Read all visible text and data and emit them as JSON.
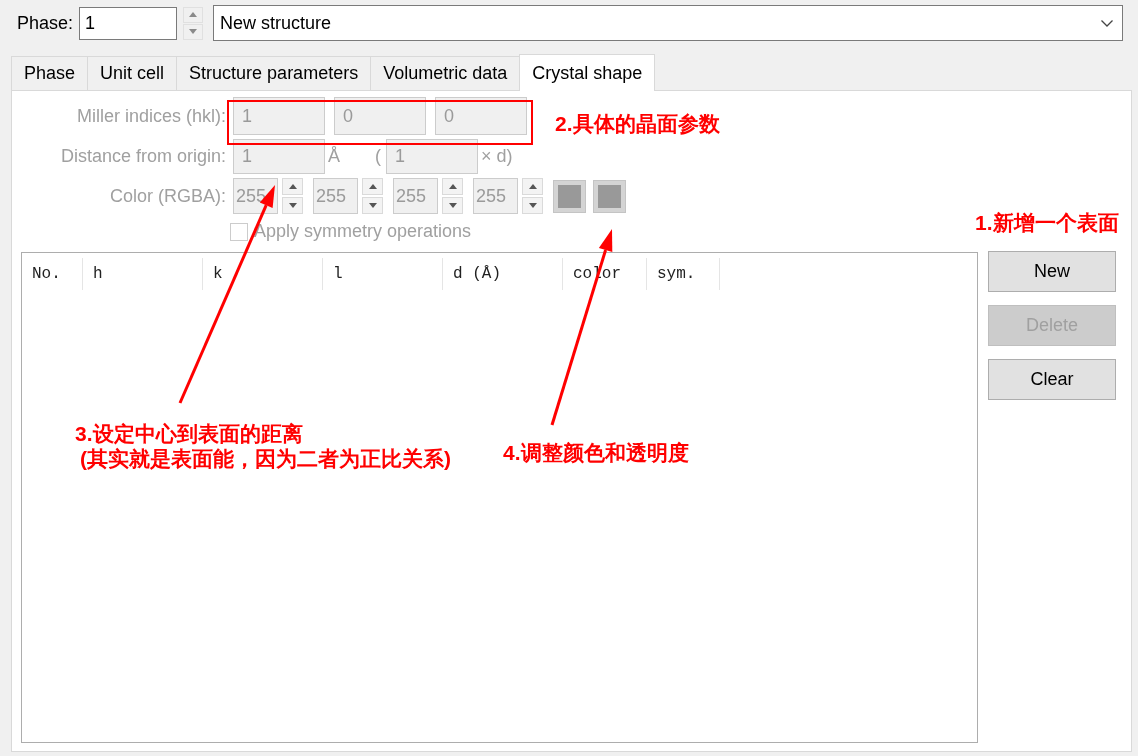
{
  "phase": {
    "label": "Phase:",
    "value": "1",
    "structure": "New structure"
  },
  "tabs": [
    {
      "label": "Phase",
      "selected": false
    },
    {
      "label": "Unit cell",
      "selected": false
    },
    {
      "label": "Structure parameters",
      "selected": false
    },
    {
      "label": "Volumetric data",
      "selected": false
    },
    {
      "label": "Crystal shape",
      "selected": true
    }
  ],
  "crystal_shape": {
    "disabled": true,
    "miller_indices": {
      "label": "Miller indices (hkl):",
      "values": [
        "1",
        "0",
        "0"
      ]
    },
    "distance": {
      "label": "Distance from origin:",
      "value": "1",
      "unit": "Å",
      "paren": "(",
      "relative_value": "1",
      "relative_unit": "× d)"
    },
    "color": {
      "label": "Color (RGBA):",
      "values": [
        "255",
        "255",
        "255",
        "255"
      ]
    },
    "apply_symmetry": {
      "label": "Apply symmetry operations",
      "checked": false
    }
  },
  "table": {
    "columns": [
      "No.",
      "h",
      "k",
      "l",
      "d (Å)",
      "color",
      "sym."
    ]
  },
  "buttons": [
    {
      "label": "New",
      "disabled": false
    },
    {
      "label": "Delete",
      "disabled": true
    },
    {
      "label": "Clear",
      "disabled": false
    }
  ],
  "annotations": [
    {
      "kind": "plain",
      "lines": [
        "1.新增一个表面"
      ]
    },
    {
      "kind": "frame",
      "lines": [
        "2.具体的晶面参数"
      ]
    },
    {
      "kind": "arrow",
      "lines": [
        "3.设定中心到表面的距离",
        "(其实就是表面能，因为二者为正比关系)"
      ]
    },
    {
      "kind": "arrow",
      "lines": [
        "4.调整颜色和透明度"
      ]
    }
  ]
}
